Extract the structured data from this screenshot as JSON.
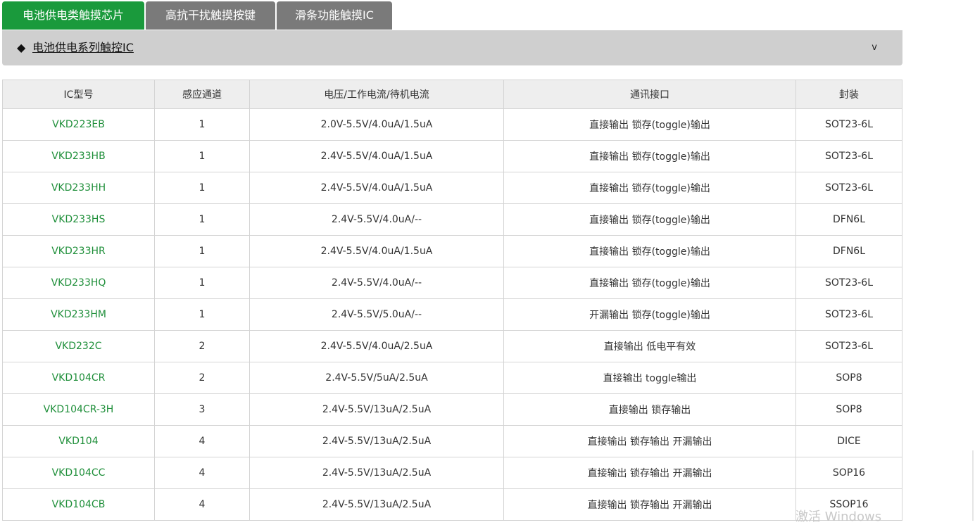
{
  "tabs": [
    {
      "label": "电池供电类触摸芯片",
      "active": true
    },
    {
      "label": "高抗干扰触摸按键",
      "active": false
    },
    {
      "label": "滑条功能触摸IC",
      "active": false
    }
  ],
  "section": {
    "marker": "◆",
    "title": "电池供电系列触控IC",
    "toggle": "v"
  },
  "table": {
    "headers": [
      "IC型号",
      "感应通道",
      "电压/工作电流/待机电流",
      "通讯接口",
      "封装"
    ],
    "rows": [
      [
        "VKD223EB",
        "1",
        "2.0V-5.5V/4.0uA/1.5uA",
        "直接输出 锁存(toggle)输出",
        "SOT23-6L"
      ],
      [
        "VKD233HB",
        "1",
        "2.4V-5.5V/4.0uA/1.5uA",
        "直接输出 锁存(toggle)输出",
        "SOT23-6L"
      ],
      [
        "VKD233HH",
        "1",
        "2.4V-5.5V/4.0uA/1.5uA",
        "直接输出 锁存(toggle)输出",
        "SOT23-6L"
      ],
      [
        "VKD233HS",
        "1",
        "2.4V-5.5V/4.0uA/--",
        "直接输出 锁存(toggle)输出",
        "DFN6L"
      ],
      [
        "VKD233HR",
        "1",
        "2.4V-5.5V/4.0uA/1.5uA",
        "直接输出 锁存(toggle)输出",
        "DFN6L"
      ],
      [
        "VKD233HQ",
        "1",
        "2.4V-5.5V/4.0uA/--",
        "直接输出 锁存(toggle)输出",
        "SOT23-6L"
      ],
      [
        "VKD233HM",
        "1",
        "2.4V-5.5V/5.0uA/--",
        "开漏输出 锁存(toggle)输出",
        "SOT23-6L"
      ],
      [
        "VKD232C",
        "2",
        "2.4V-5.5V/4.0uA/2.5uA",
        "直接输出 低电平有效",
        "SOT23-6L"
      ],
      [
        "VKD104CR",
        "2",
        "2.4V-5.5V/5uA/2.5uA",
        "直接输出 toggle输出",
        "SOP8"
      ],
      [
        "VKD104CR-3H",
        "3",
        "2.4V-5.5V/13uA/2.5uA",
        "直接输出 锁存输出",
        "SOP8"
      ],
      [
        "VKD104",
        "4",
        "2.4V-5.5V/13uA/2.5uA",
        "直接输出 锁存输出 开漏输出",
        "DICE"
      ],
      [
        "VKD104CC",
        "4",
        "2.4V-5.5V/13uA/2.5uA",
        "直接输出 锁存输出 开漏输出",
        "SOP16"
      ],
      [
        "VKD104CB",
        "4",
        "2.4V-5.5V/13uA/2.5uA",
        "直接输出 锁存输出 开漏输出",
        "SSOP16"
      ]
    ]
  },
  "watermark": "激活 Windows",
  "colors": {
    "active_tab": "#1a9a3c",
    "inactive_tab": "#7a7a7a",
    "section_bar": "#cfcfcf",
    "model_link": "#1f8f3a",
    "header_bg": "#eeeeee",
    "border": "#d4d4d4"
  }
}
